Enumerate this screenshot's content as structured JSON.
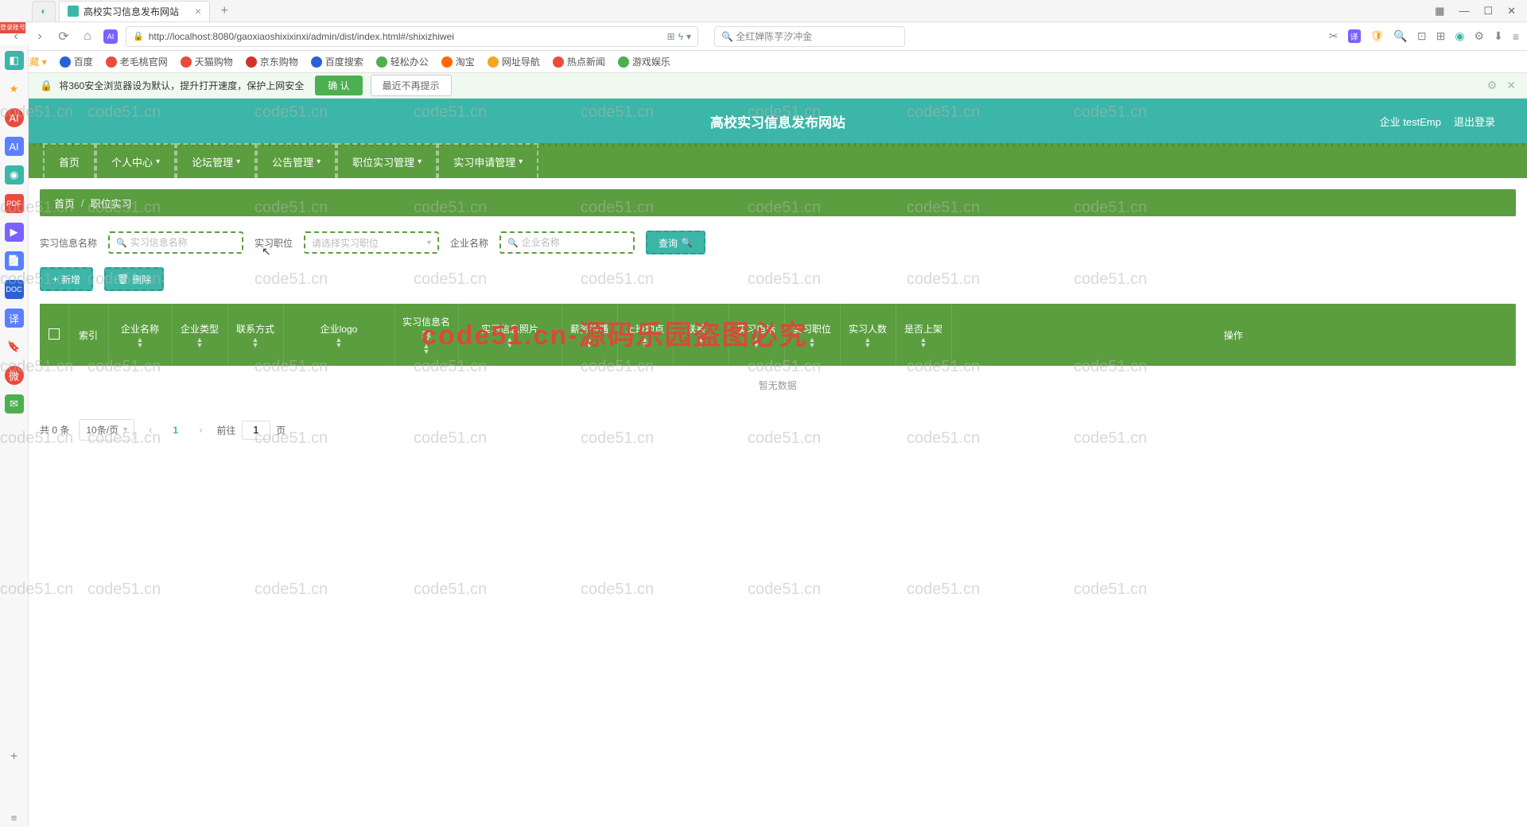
{
  "browser": {
    "tab_blank_glyph": "◐",
    "tab_title": "高校实习信息发布网站",
    "tab_close": "×",
    "tab_new": "+",
    "window": {
      "grid": "▦",
      "min": "—",
      "max": "☐",
      "close": "✕"
    },
    "nav_back": "‹",
    "nav_fwd": "›",
    "reload": "⟳",
    "home": "⌂",
    "url": "http://localhost:8080/gaoxiaoshixixinxi/admin/dist/index.html#/shixizhiwei",
    "search_placeholder": "🔍 全红婵陈芋汐冲金",
    "login_badge": "登录账号"
  },
  "bookmarks": {
    "fav": "★ 收藏 ▾",
    "items": [
      "百度",
      "老毛桃官网",
      "天猫购物",
      "京东购物",
      "百度搜索",
      "轻松办公",
      "淘宝",
      "网址导航",
      "热点新闻",
      "游戏娱乐"
    ]
  },
  "sec_bar": {
    "text": "将360安全浏览器设为默认，提升打开速度，保护上网安全",
    "confirm": "确 认",
    "later": "最近不再提示"
  },
  "app": {
    "title": "高校实习信息发布网站",
    "user": "企业 testEmp",
    "logout": "退出登录"
  },
  "menu": [
    "首页",
    "个人中心",
    "论坛管理",
    "公告管理",
    "职位实习管理",
    "实习申请管理"
  ],
  "breadcrumb": {
    "a": "首页",
    "b": "职位实习"
  },
  "filters": {
    "l1": "实习信息名称",
    "p1": "实习信息名称",
    "l2": "实习职位",
    "p2": "请选择实习职位",
    "l3": "企业名称",
    "p3": "企业名称",
    "query": "查询"
  },
  "actions": {
    "add": "新增",
    "del": "删除"
  },
  "table": {
    "cols": [
      "",
      "索引",
      "企业名称",
      "企业类型",
      "联系方式",
      "企业logo",
      "实习信息名称",
      "实习信息照片",
      "薪资待遇",
      "上班地点",
      "联系人",
      "实习电话",
      "实习职位",
      "实习人数",
      "是否上架",
      "操作"
    ],
    "no_data": "暂无数据"
  },
  "pagination": {
    "total": "共 0 条",
    "per_page": "10条/页",
    "goto": "前往",
    "page": "页",
    "current": "1",
    "jump_val": "1"
  },
  "watermark_text": "code51.cn",
  "watermark_red": "code51.cn-源码乐园盗图必究"
}
